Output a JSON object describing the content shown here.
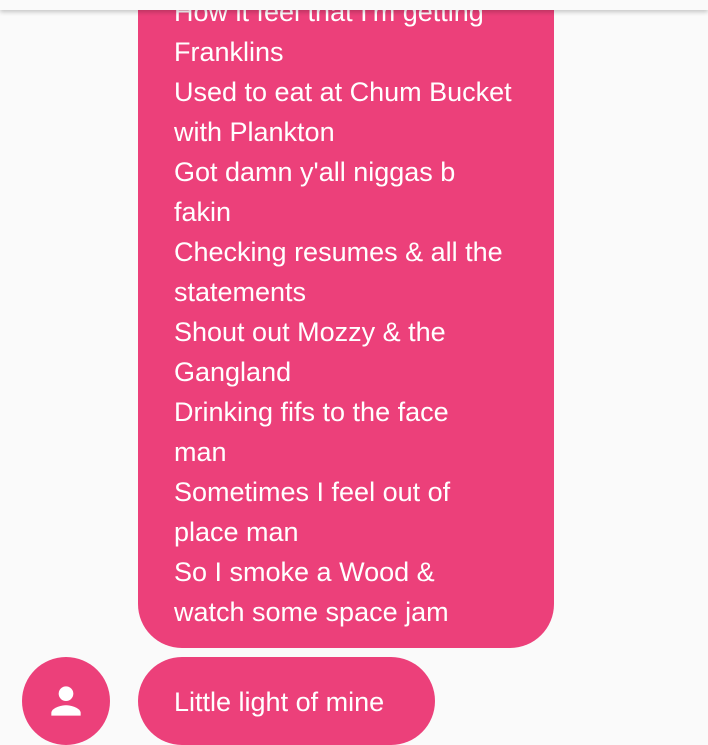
{
  "conversation": {
    "message_long_lines": [
      "How it feel that I'm getting",
      "Franklins",
      "Used to eat at Chum Bucket",
      "with Plankton",
      "Got damn y'all niggas b",
      "fakin",
      "Checking resumes & all the",
      "statements",
      "Shout out Mozzy & the",
      "Gangland",
      "Drinking fifs to the face",
      "man",
      "Sometimes I feel out of",
      "place man",
      "So I smoke a Wood &",
      "watch some space jam"
    ],
    "message_short": "Little light of mine"
  },
  "avatar": {
    "icon": "person-icon"
  },
  "colors": {
    "bubble": "#ec407a",
    "bubble_text": "#ffffff",
    "background": "#fafafa"
  }
}
